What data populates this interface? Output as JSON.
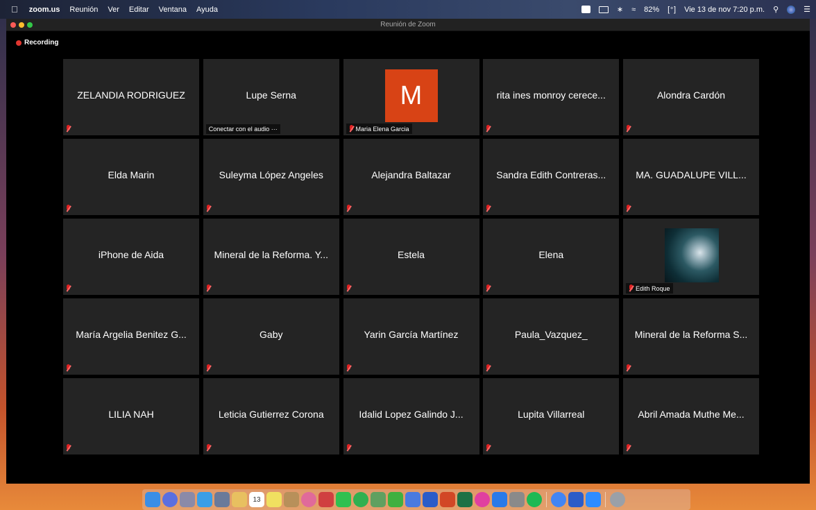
{
  "menubar": {
    "app_name": "zoom.us",
    "menus": [
      "Reunión",
      "Ver",
      "Editar",
      "Ventana",
      "Ayuda"
    ],
    "battery": "82%",
    "datetime": "Vie 13 de nov  7:20 p.m."
  },
  "window": {
    "title": "Reunión de Zoom",
    "recording_label": "Recording"
  },
  "participants": [
    {
      "name": "ZELANDIA RODRIGUEZ",
      "muted": true
    },
    {
      "name": "Lupe Serna",
      "caption": "Conectar con el audio ···"
    },
    {
      "name": "",
      "avatar_letter": "M",
      "caption": "Maria Elena Garcia",
      "muted": true
    },
    {
      "name": "rita ines monroy cerece...",
      "muted": true
    },
    {
      "name": "Alondra Cardón",
      "muted": true
    },
    {
      "name": "Elda Marin",
      "muted": true
    },
    {
      "name": "Suleyma López Angeles",
      "muted": true
    },
    {
      "name": "Alejandra Baltazar",
      "muted": true
    },
    {
      "name": "Sandra Edith Contreras...",
      "muted": true
    },
    {
      "name": "MA. GUADALUPE VILL...",
      "muted": true
    },
    {
      "name": "iPhone de Aida",
      "muted": true
    },
    {
      "name": "Mineral de la Reforma. Y...",
      "muted": true
    },
    {
      "name": "Estela",
      "muted": true
    },
    {
      "name": "Elena",
      "muted": true
    },
    {
      "name": "",
      "photo": true,
      "caption": "Edith Roque",
      "muted": true
    },
    {
      "name": "María Argelia Benitez G...",
      "muted": true
    },
    {
      "name": "Gaby",
      "muted": true
    },
    {
      "name": "Yarin García Martínez",
      "muted": true
    },
    {
      "name": "Paula_Vazquez_",
      "muted": true
    },
    {
      "name": "Mineral de la Reforma S...",
      "muted": true
    },
    {
      "name": "LILIA  NAH",
      "muted": true
    },
    {
      "name": "Leticia Gutierrez Corona",
      "muted": true
    },
    {
      "name": "Idalid Lopez Galindo  J...",
      "muted": true
    },
    {
      "name": "Lupita Villarreal",
      "muted": true
    },
    {
      "name": "Abril Amada Muthe Me...",
      "muted": true
    }
  ],
  "dock": {
    "calendar_day": "13",
    "apps": [
      "finder",
      "siri",
      "launchpad",
      "safari",
      "preview",
      "notes",
      "calendar",
      "stickies",
      "contacts",
      "photos",
      "photobooth",
      "messages",
      "facetime",
      "maps",
      "numbers",
      "keynote",
      "word",
      "powerpoint",
      "excel",
      "itunes",
      "appstore",
      "system-preferences",
      "spotify",
      "chrome",
      "word",
      "zoom",
      "trash"
    ],
    "colors": [
      "#3a8ee6",
      "#5b6fe0",
      "#8a8aa8",
      "#3a9ee6",
      "#6a7a9a",
      "#e8c060",
      "#ffffff",
      "#f0e060",
      "#b8905a",
      "#e06a9a",
      "#d04040",
      "#30c050",
      "#30b050",
      "#60a060",
      "#40b040",
      "#4a7ae0",
      "#2b5cc8",
      "#d24726",
      "#1e7145",
      "#e040a0",
      "#2a7ae8",
      "#8a8a8a",
      "#1db954",
      "#4285f4",
      "#2b5cc8",
      "#2d8cff",
      "#9aa0a8"
    ]
  }
}
